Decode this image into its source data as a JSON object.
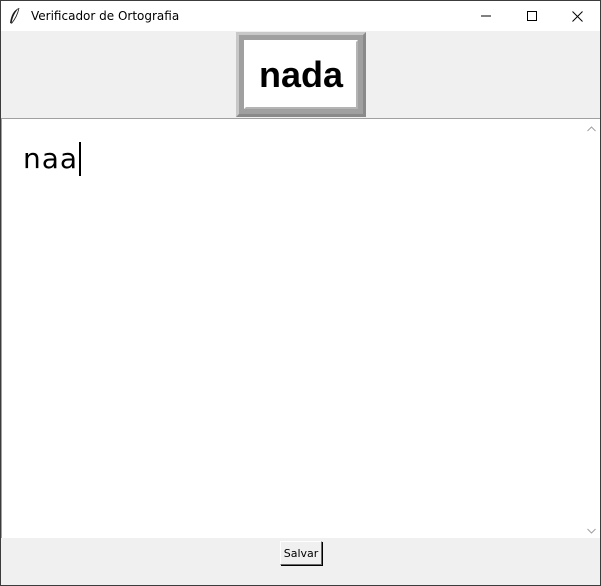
{
  "window": {
    "title": "Verificador de Ortografia",
    "icon": "feather-icon",
    "controls": [
      "minimize-icon",
      "maximize-icon",
      "close-icon"
    ]
  },
  "suggestion": {
    "word": "nada"
  },
  "editor": {
    "text": "naa"
  },
  "footer": {
    "save_label": "Salvar"
  },
  "colors": {
    "window_bg": "#f0f0f0",
    "editor_bg": "#ffffff",
    "frame_gray": "#a0a0a0"
  }
}
